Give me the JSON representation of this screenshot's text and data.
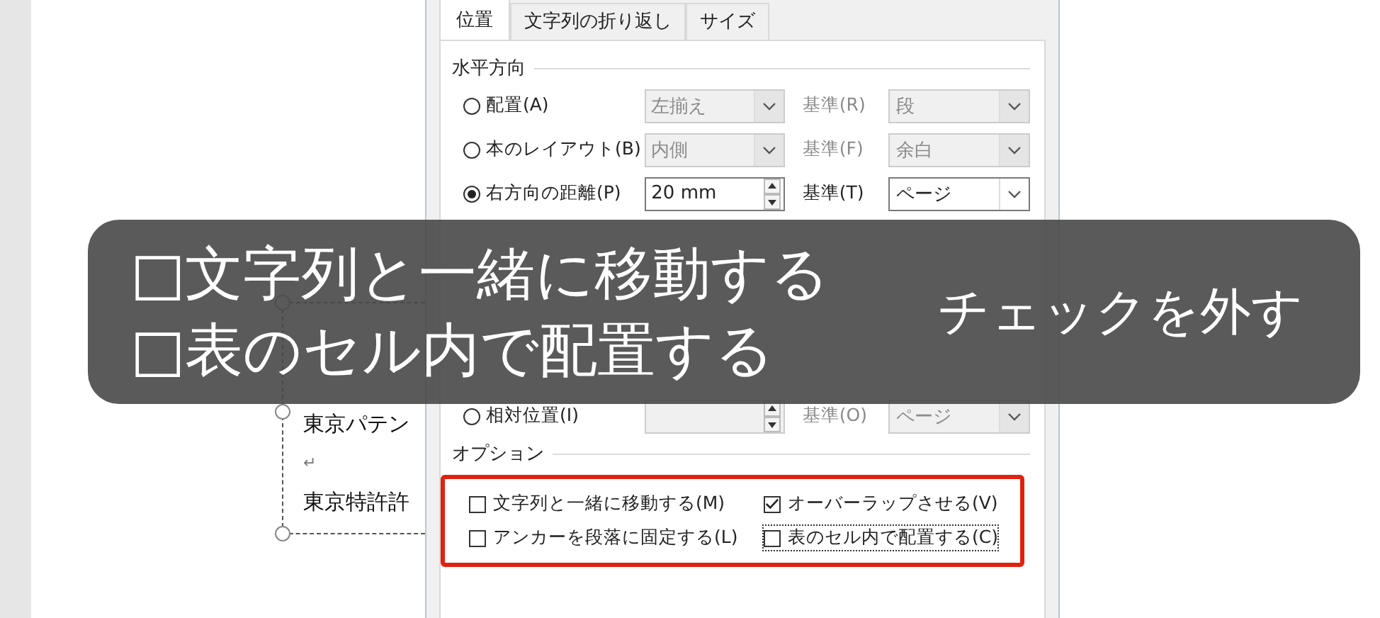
{
  "document": {
    "lines": [
      {
        "kind": "text",
        "text": "東京パテン"
      },
      {
        "kind": "mark",
        "text": "↵"
      },
      {
        "kind": "text",
        "text": "東京特許許"
      }
    ]
  },
  "dialog": {
    "tabs": [
      {
        "label": "位置",
        "selected": true
      },
      {
        "label": "文字列の折り返し",
        "selected": false
      },
      {
        "label": "サイズ",
        "selected": false
      }
    ],
    "horizontal": {
      "title": "水平方向",
      "rows": [
        {
          "label": "配置(A)",
          "selected": false,
          "disabled": true,
          "field": {
            "kind": "dropdown",
            "value": "左揃え"
          },
          "base_label": "基準(R)",
          "base_value": "段"
        },
        {
          "label": "本のレイアウト(B)",
          "selected": false,
          "disabled": true,
          "field": {
            "kind": "dropdown",
            "value": "内側"
          },
          "base_label": "基準(F)",
          "base_value": "余白"
        },
        {
          "label": "右方向の距離(P)",
          "selected": true,
          "disabled": false,
          "field": {
            "kind": "spin",
            "value": "20 mm"
          },
          "base_label": "基準(T)",
          "base_value": "ページ"
        }
      ]
    },
    "vertical_rows": [
      {
        "label": "相対位置(I)",
        "selected": false,
        "disabled": true,
        "field": {
          "kind": "spin"
        },
        "base_label": "基準(O)",
        "base_value": "ページ"
      }
    ],
    "options": {
      "title": "オプション",
      "highlighted": true,
      "checkboxes": [
        {
          "label": "文字列と一緒に移動する(M)",
          "checked": false,
          "focused": false
        },
        {
          "label": "オーバーラップさせる(V)",
          "checked": true,
          "focused": false
        },
        {
          "label": "アンカーを段落に固定する(L)",
          "checked": false,
          "focused": false
        },
        {
          "label": "表のセル内で配置する(C)",
          "checked": false,
          "focused": true
        }
      ]
    }
  },
  "caption": {
    "lines": [
      "□文字列と一緒に移動する",
      "□表のセル内で配置する"
    ],
    "note": "チェックを外す"
  }
}
